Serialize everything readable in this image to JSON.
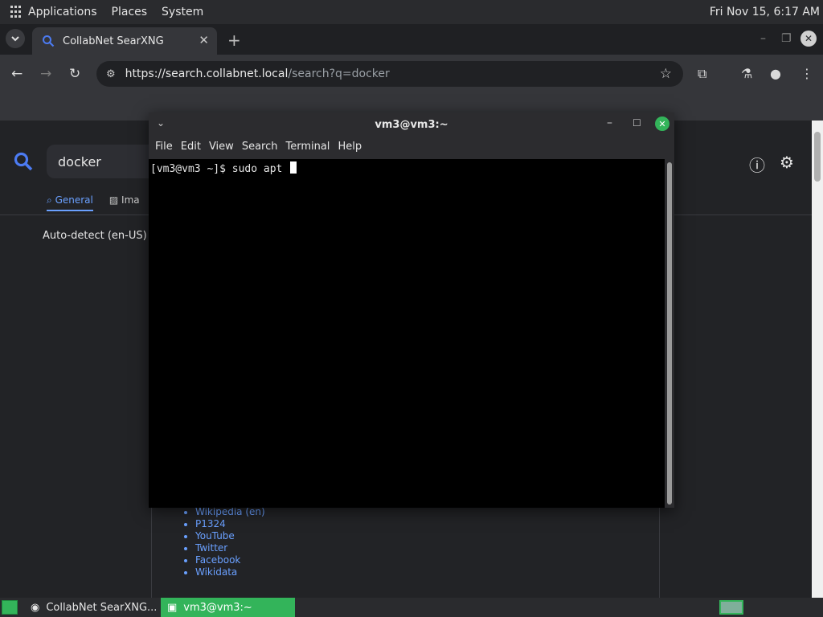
{
  "top_panel": {
    "menus": [
      "Applications",
      "Places",
      "System"
    ],
    "clock": "Fri Nov 15,  6:17 AM"
  },
  "browser": {
    "tab_title": "CollabNet SearXNG",
    "url_host": "https://search.collabnet.local",
    "url_path": "/search?q=docker",
    "search_query": "docker",
    "categories": [
      "General",
      "Ima"
    ],
    "language": "Auto-detect (en-US)",
    "links": [
      "Wikipedia (en)",
      "P1324",
      "YouTube",
      "Twitter",
      "Facebook",
      "Wikidata"
    ]
  },
  "terminal": {
    "title": "vm3@vm3:~",
    "menu": [
      "File",
      "Edit",
      "View",
      "Search",
      "Terminal",
      "Help"
    ],
    "prompt_line": "[vm3@vm3 ~]$ sudo apt "
  },
  "taskbar": {
    "items": [
      "CollabNet SearXNG...",
      "vm3@vm3:~"
    ]
  },
  "colors": {
    "accent_green": "#33b45a",
    "link_blue": "#6aa0ff",
    "search_blue": "#4c7bf2"
  }
}
